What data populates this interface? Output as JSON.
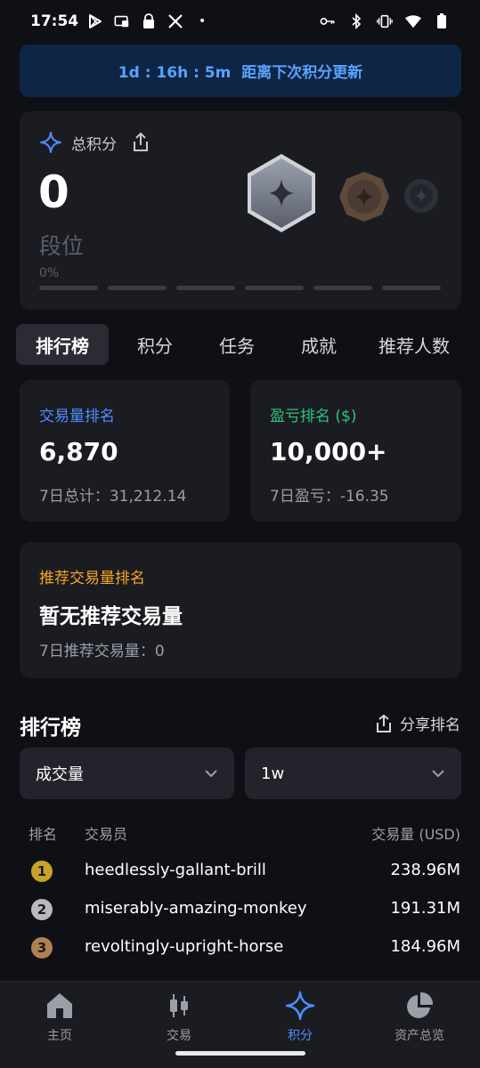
{
  "status_bar": {
    "time": "17:54",
    "dot": "•"
  },
  "banner": {
    "text": "1d : 16h : 5m  距离下次积分更新"
  },
  "points": {
    "label": "总积分",
    "value": "0",
    "rank_label": "段位",
    "progress_label": "0%",
    "progress_fraction": 0
  },
  "tabs": [
    {
      "label": "排行榜",
      "active": true
    },
    {
      "label": "积分",
      "active": false
    },
    {
      "label": "任务",
      "active": false
    },
    {
      "label": "成就",
      "active": false
    },
    {
      "label": "推荐人数",
      "active": false
    }
  ],
  "stats": {
    "volume_rank": {
      "title": "交易量排名",
      "value": "6,870",
      "sub": "7日总计：31,212.14"
    },
    "pnl_rank": {
      "title": "盈亏排名 ($)",
      "value": "10,000+",
      "sub": "7日盈亏：-16.35"
    },
    "referral_rank": {
      "title": "推荐交易量排名",
      "value": "暂无推荐交易量",
      "sub": "7日推荐交易量：0"
    }
  },
  "leaderboard": {
    "title": "排行榜",
    "share_label": "分享排名",
    "metric_select": "成交量",
    "period_select": "1w",
    "columns": {
      "rank": "排名",
      "trader": "交易员",
      "volume": "交易量 (USD)"
    },
    "rows": [
      {
        "rank": "1",
        "trader": "heedlessly-gallant-brill",
        "volume": "238.96M"
      },
      {
        "rank": "2",
        "trader": "miserably-amazing-monkey",
        "volume": "191.31M"
      },
      {
        "rank": "3",
        "trader": "revoltingly-upright-horse",
        "volume": "184.96M"
      }
    ]
  },
  "bottom_nav": [
    {
      "label": "主页",
      "icon": "home-icon",
      "active": false
    },
    {
      "label": "交易",
      "icon": "candlestick-icon",
      "active": false
    },
    {
      "label": "积分",
      "icon": "sparkle-icon",
      "active": true
    },
    {
      "label": "资产总览",
      "icon": "pie-chart-icon",
      "active": false
    }
  ],
  "colors": {
    "accent_blue": "#4d8dff",
    "green": "#2ec27e",
    "orange": "#f5a524",
    "gold": "#c9a227",
    "silver": "#b8b9bf",
    "bronze": "#b08052"
  }
}
